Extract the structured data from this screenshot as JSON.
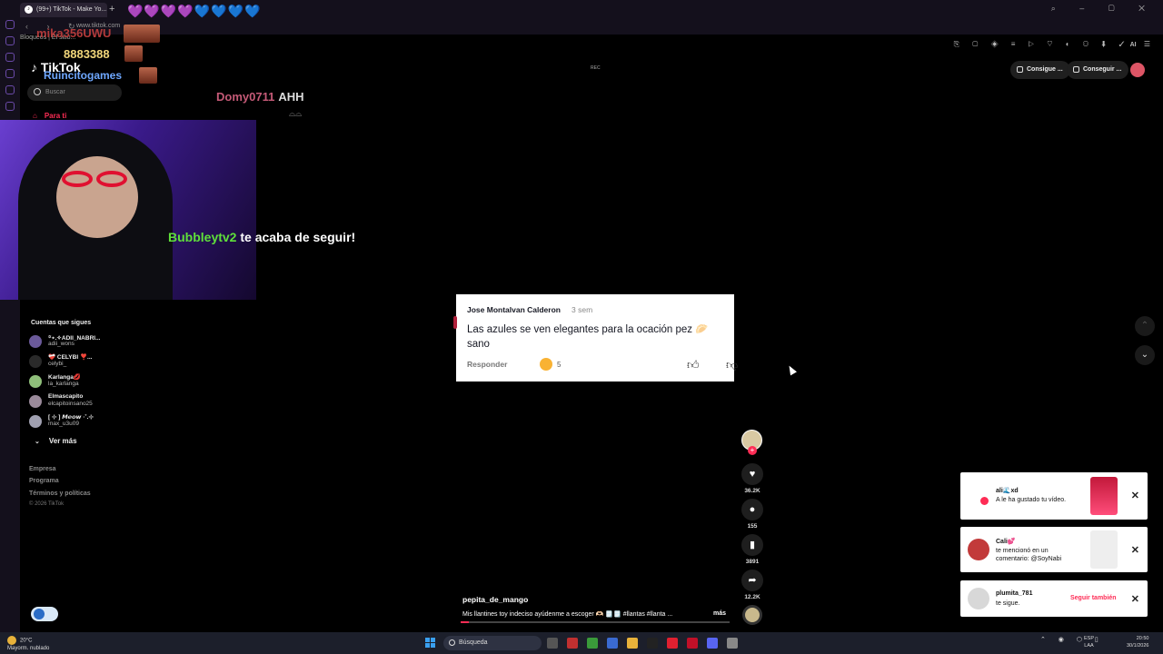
{
  "browser": {
    "tab_title": "(99+) TikTok - Make Yo...",
    "tab_hearts": "💜💜💜💜💙💙💙💙",
    "url": "www.tiktok.com",
    "bookmark_line": "Bloqueos | El sitio..."
  },
  "stream": {
    "overlay_user": "mika356UWU",
    "overlay_number": "8883388",
    "overlay_user2": "Ruincitogames",
    "chat_user": "Domy0711",
    "chat_msg": "AHH",
    "follow_alert_name": "Bubbleytv2",
    "follow_alert_text": "te acaba de seguir!"
  },
  "tiktok": {
    "logo": "TikTok",
    "search_placeholder": "Buscar",
    "nav_for_you": "Para ti",
    "following_header": "Cuentas que sigues",
    "accounts": [
      {
        "display": "꙳⋆.✧ADII_NABRI...",
        "handle": "adii_wons"
      },
      {
        "display": "❤️‍🩹 CELYBI ❣️...",
        "handle": "celybi_"
      },
      {
        "display": "Karlanga💋",
        "handle": "la_karlanga"
      },
      {
        "display": "Elmascapito",
        "handle": "elcapitoinsano25"
      },
      {
        "display": "[ ⊹ ] 𝙈𝙚𝙤𝙬 ·˚.⊹",
        "handle": "max_u3u09"
      }
    ],
    "see_more": "Ver más",
    "footer_links": [
      "Empresa",
      "Programa",
      "Términos y políticas"
    ],
    "copyright": "© 2026 TikTok",
    "top_buttons": [
      "Consigue ...",
      "Conseguir ..."
    ],
    "rec_label": "REC"
  },
  "comment": {
    "user": "Jose Montalvan Calderon",
    "time": "3 sem",
    "text": "Las azules se ven elegantes para la ocación pez 🥟 sano",
    "reply": "Responder",
    "reaction_count": "5"
  },
  "actions": {
    "likes": "36.2K",
    "comments": "155",
    "saves": "3891",
    "shares": "12.2K",
    "progress_fraction": 0.03
  },
  "video": {
    "author": "pepita_de_mango",
    "description": "Mis llantines toy indeciso ayúdenme a escoger 🫶🏻 🗒️🗒️ #llantas #llanta ...",
    "more": "más"
  },
  "notifications": [
    {
      "name": "ali🌊xd",
      "msg": "A le ha gustado tu vídeo."
    },
    {
      "name": "Cali💕",
      "msg": "te mencionó en un comentario: @SoyNabi"
    },
    {
      "name": "plumita_781",
      "msg": "te sigue.",
      "action": "Seguir también"
    }
  ],
  "taskbar": {
    "temp": "20°C",
    "weather": "Mayorm. nublado",
    "search": "Búsqueda",
    "lang_line1": "ESP",
    "lang_line2": "LAA",
    "time": "20:50",
    "date": "30/1/2026"
  },
  "colors": {
    "tiktok_red": "#fe2c55",
    "alert_green": "#5fe03a",
    "overlay_red": "#b23a3a",
    "overlay_gold": "#f2d77b"
  }
}
